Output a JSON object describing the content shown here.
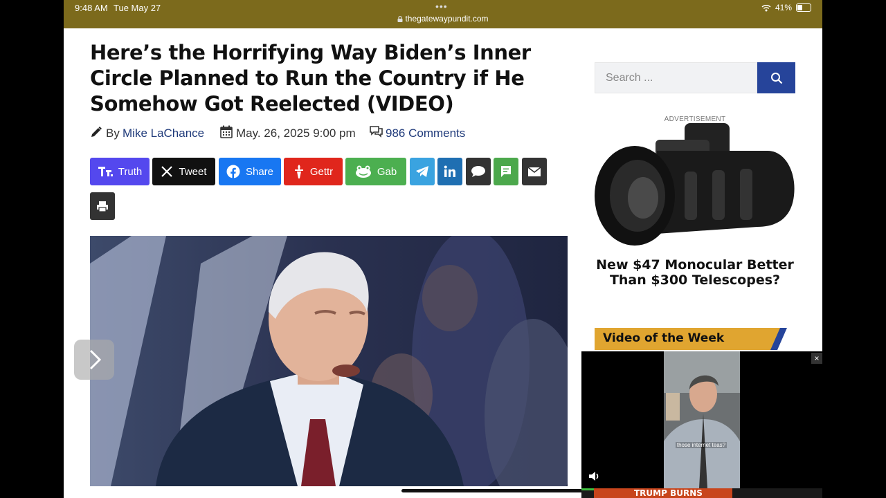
{
  "status_bar": {
    "time": "9:48 AM",
    "date": "Tue May 27",
    "dots": "•••",
    "url": "thegatewaypundit.com",
    "battery": "41%",
    "wifi_icon": "wifi-icon",
    "battery_icon": "battery-icon",
    "lock_icon": "lock-icon"
  },
  "article": {
    "title": "Here’s the Horrifying Way Biden’s Inner Circle Planned to Run the Country if He Somehow Got Reelected (VIDEO)",
    "by_label": "By",
    "author": "Mike LaChance",
    "date": "May. 26, 2025 9:00 pm",
    "comments": "986 Comments"
  },
  "share_buttons": [
    {
      "label": "Truth",
      "icon": "truth-social-icon",
      "color": "#5448ee"
    },
    {
      "label": "Tweet",
      "icon": "x-icon",
      "color": "#111111"
    },
    {
      "label": "Share",
      "icon": "facebook-icon",
      "color": "#1877f2"
    },
    {
      "label": "Gettr",
      "icon": "gettr-icon",
      "color": "#e0261c"
    },
    {
      "label": "Gab",
      "icon": "gab-icon",
      "color": "#4caf50"
    },
    {
      "label": "",
      "icon": "telegram-icon",
      "color": "#3aa3e0"
    },
    {
      "label": "",
      "icon": "linkedin-icon",
      "color": "#1f6fb2"
    },
    {
      "label": "",
      "icon": "comment-icon",
      "color": "#333333"
    },
    {
      "label": "",
      "icon": "sms-icon",
      "color": "#4ca84c"
    },
    {
      "label": "",
      "icon": "email-icon",
      "color": "#333333"
    },
    {
      "label": "",
      "icon": "print-icon",
      "color": "#333333"
    }
  ],
  "sidebar": {
    "search_placeholder": "Search ...",
    "ad_label": "ADVERTISEMENT",
    "ad_caption": "New $47 Monocular Better Than $300 Telescopes?",
    "video_heading": "Video of the Week"
  },
  "video_player": {
    "close_label": "×",
    "caption": "those internet teas?",
    "banner_text": "TRUMP BURNS"
  },
  "colors": {
    "status_bar": "#7c6a1c",
    "search_button": "#26449a",
    "video_heading_bg": "#e0a530",
    "link": "#1f3a7a"
  }
}
